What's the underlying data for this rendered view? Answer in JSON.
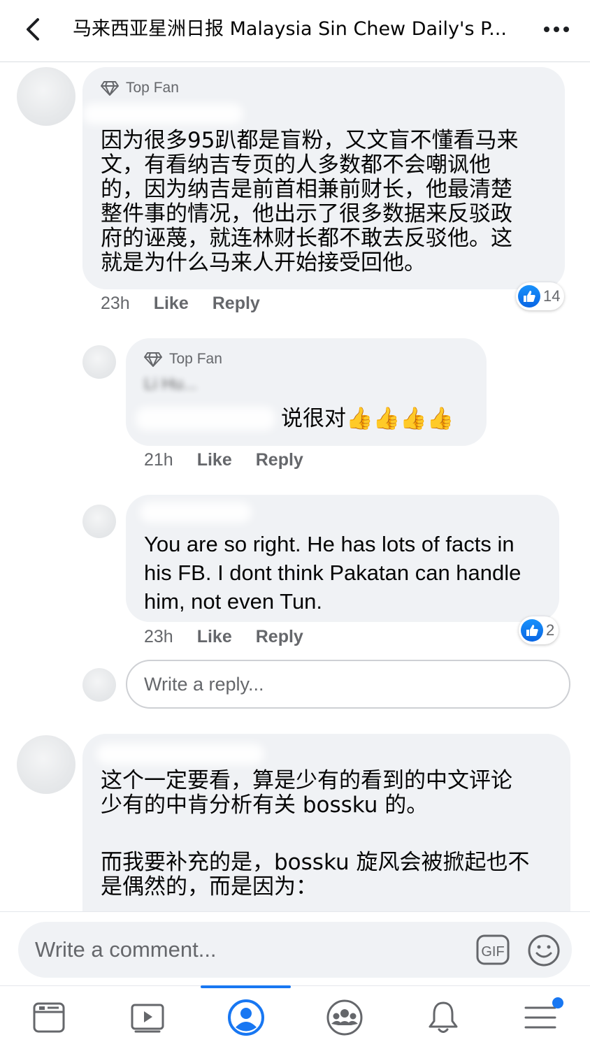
{
  "header": {
    "title": "马来西亚星洲日报 Malaysia Sin Chew Daily's P...",
    "back_icon": "chevron-left-icon",
    "more_icon": "more-horizontal-icon"
  },
  "comments": [
    {
      "badge": "Top Fan",
      "text": [
        "因为很多95趴都是盲粉，又文盲不懂看马来",
        "文，有看纳吉专页的人多数都不会嘲讽他",
        "的，因为纳吉是前首相兼前财长，他最清楚",
        "整件事的情况，他出示了很多数据来反驳政",
        "府的诬蔑，就连林财长都不敢去反驳他。这",
        "就是为什么马来人开始接受回他。"
      ],
      "time": "23h",
      "like": "Like",
      "reply": "Reply",
      "reactions": "14"
    },
    {
      "badge": "Top Fan",
      "name": "Li Hu...",
      "text": "说很对👍👍👍👍",
      "time": "21h",
      "like": "Like",
      "reply": "Reply"
    },
    {
      "text": [
        "You are so right. He has lots of facts in",
        "his FB. I dont think Pakatan can handle",
        "him, not even Tun."
      ],
      "time": "23h",
      "like": "Like",
      "reply": "Reply",
      "reactions": "2"
    },
    {
      "text": [
        "这个一定要看，算是少有的看到的中文评论",
        "少有的中肯分析有关 bossku 的。",
        "",
        "而我要补充的是，bossku 旋风会被掀起也不",
        "是偶然的，而是因为："
      ]
    }
  ],
  "reply_input": {
    "placeholder": "Write a reply..."
  },
  "comment_bar": {
    "placeholder": "Write a comment...",
    "gif_label": "GIF"
  },
  "bottom_nav": {
    "items": [
      "news-feed-icon",
      "watch-video-icon",
      "profile-icon",
      "groups-icon",
      "notifications-bell-icon",
      "menu-icon"
    ],
    "active": "profile-icon"
  },
  "colors": {
    "accent": "#1877f2",
    "bubble": "#f0f2f5",
    "secondary_text": "#65676b"
  }
}
